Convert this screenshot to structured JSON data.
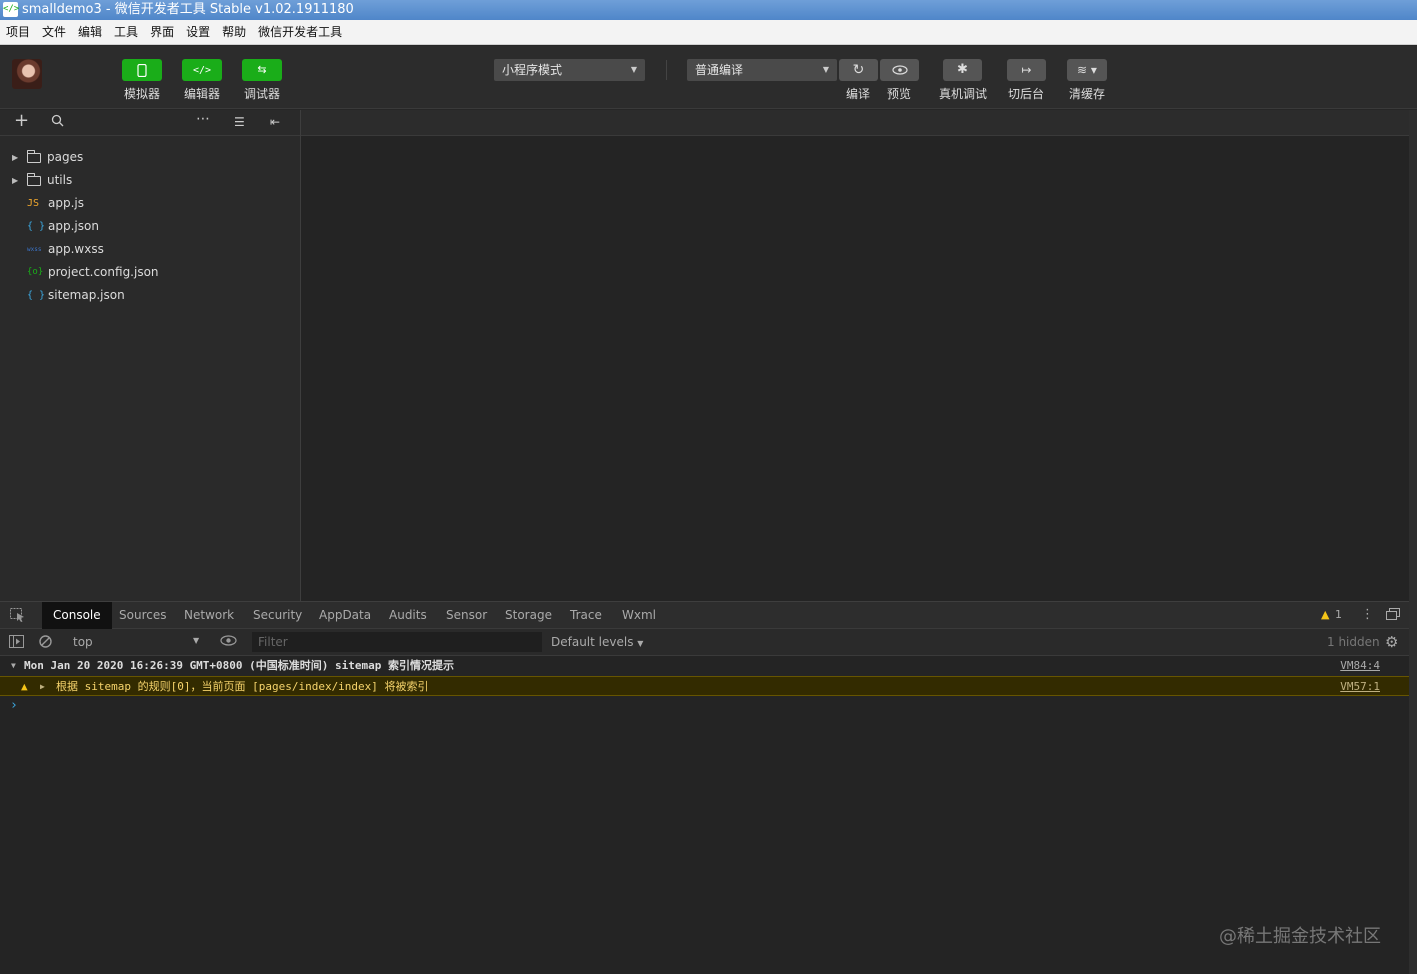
{
  "window": {
    "title": "smalldemo3 - 微信开发者工具 Stable v1.02.1911180"
  },
  "menu": [
    "项目",
    "文件",
    "编辑",
    "工具",
    "界面",
    "设置",
    "帮助",
    "微信开发者工具"
  ],
  "toolbar": {
    "simulator_label": "模拟器",
    "editor_label": "编辑器",
    "debugger_label": "调试器",
    "mode_select": "小程序模式",
    "compile_select": "普通编译",
    "compile_label": "编译",
    "preview_label": "预览",
    "remote_debug_label": "真机调试",
    "background_label": "切后台",
    "clear_cache_label": "清缓存"
  },
  "files": [
    {
      "type": "folder",
      "name": "pages"
    },
    {
      "type": "folder",
      "name": "utils"
    },
    {
      "type": "js",
      "icon_text": "JS",
      "color": "#f0a72d",
      "name": "app.js"
    },
    {
      "type": "json",
      "icon_text": "{ }",
      "color": "#3ca8e0",
      "name": "app.json"
    },
    {
      "type": "wxss",
      "icon_text": "wxss",
      "color": "#3b74c9",
      "name": "app.wxss"
    },
    {
      "type": "config",
      "icon_text": "{o}",
      "color": "#1aad19",
      "name": "project.config.json"
    },
    {
      "type": "json",
      "icon_text": "{ }",
      "color": "#3ca8e0",
      "name": "sitemap.json"
    }
  ],
  "devtools": {
    "tabs": [
      "Console",
      "Sources",
      "Network",
      "Security",
      "AppData",
      "Audits",
      "Sensor",
      "Storage",
      "Trace",
      "Wxml"
    ],
    "active_tab": "Console",
    "warning_count": "1",
    "context": "top",
    "filter_placeholder": "Filter",
    "levels": "Default levels",
    "hidden": "1 hidden",
    "logs": [
      {
        "text": "Mon Jan 20 2020 16:26:39 GMT+0800 (中国标准时间) sitemap 索引情况提示",
        "source": "VM84:4"
      },
      {
        "text": "根据 sitemap 的规则[0]，当前页面 [pages/index/index] 将被索引",
        "source": "VM57:1"
      }
    ],
    "prompt": "›"
  },
  "watermark": "@稀土掘金技术社区"
}
